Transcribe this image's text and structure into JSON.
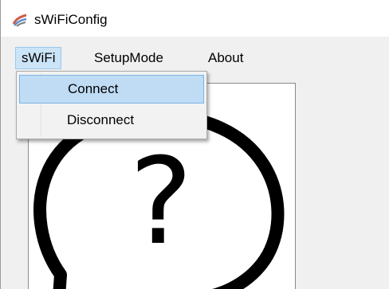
{
  "window": {
    "title": "sWiFiConfig",
    "icon": "wifi-app-icon"
  },
  "menubar": {
    "items": [
      {
        "label": "sWiFi",
        "open": true
      },
      {
        "label": "SetupMode"
      },
      {
        "label": "About"
      }
    ]
  },
  "dropdown": {
    "items": [
      {
        "label": "Connect",
        "highlighted": true
      },
      {
        "label": "Disconnect"
      }
    ]
  },
  "status_display": {
    "glyph": "?",
    "icon": "unknown-status-icon"
  },
  "colors": {
    "highlight": "#bfdcf4",
    "menu_open": "#cce4f7"
  }
}
